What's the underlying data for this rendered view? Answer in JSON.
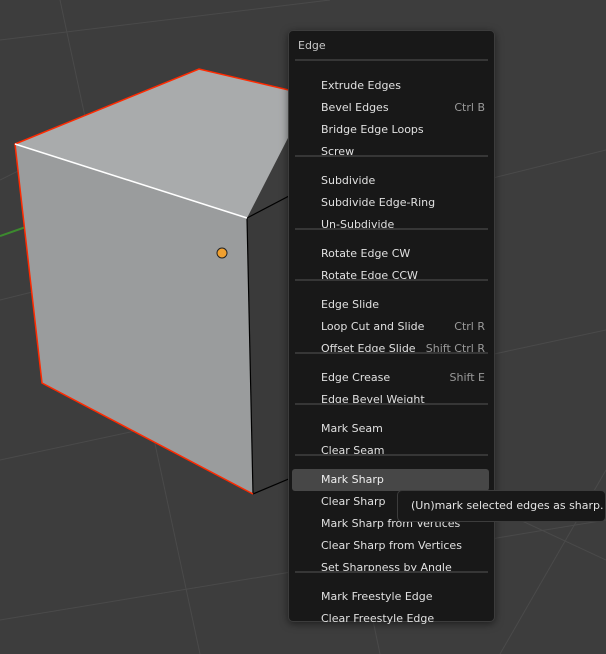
{
  "menu": {
    "title": "Edge",
    "groups": [
      [
        {
          "label": "Extrude Edges"
        },
        {
          "label": "Bevel Edges",
          "shortcut": "Ctrl B"
        },
        {
          "label": "Bridge Edge Loops"
        },
        {
          "label": "Screw"
        }
      ],
      [
        {
          "label": "Subdivide"
        },
        {
          "label": "Subdivide Edge-Ring"
        },
        {
          "label": "Un-Subdivide"
        }
      ],
      [
        {
          "label": "Rotate Edge CW"
        },
        {
          "label": "Rotate Edge CCW"
        }
      ],
      [
        {
          "label": "Edge Slide"
        },
        {
          "label": "Loop Cut and Slide",
          "shortcut": "Ctrl R"
        },
        {
          "label": "Offset Edge Slide",
          "shortcut": "Shift Ctrl R"
        }
      ],
      [
        {
          "label": "Edge Crease",
          "shortcut": "Shift E"
        },
        {
          "label": "Edge Bevel Weight"
        }
      ],
      [
        {
          "label": "Mark Seam"
        },
        {
          "label": "Clear Seam"
        }
      ],
      [
        {
          "label": "Mark Sharp",
          "highlighted": true
        },
        {
          "label": "Clear Sharp"
        },
        {
          "label": "Mark Sharp from Vertices"
        },
        {
          "label": "Clear Sharp from Vertices"
        },
        {
          "label": "Set Sharpness by Angle"
        }
      ],
      [
        {
          "label": "Mark Freestyle Edge"
        },
        {
          "label": "Clear Freestyle Edge"
        }
      ]
    ]
  },
  "tooltip": {
    "text": "(Un)mark selected edges as sharp."
  },
  "colors": {
    "viewport_bg": "#3d3d3d",
    "selected_edge": "#ff2a00",
    "origin": "#f0a030"
  }
}
